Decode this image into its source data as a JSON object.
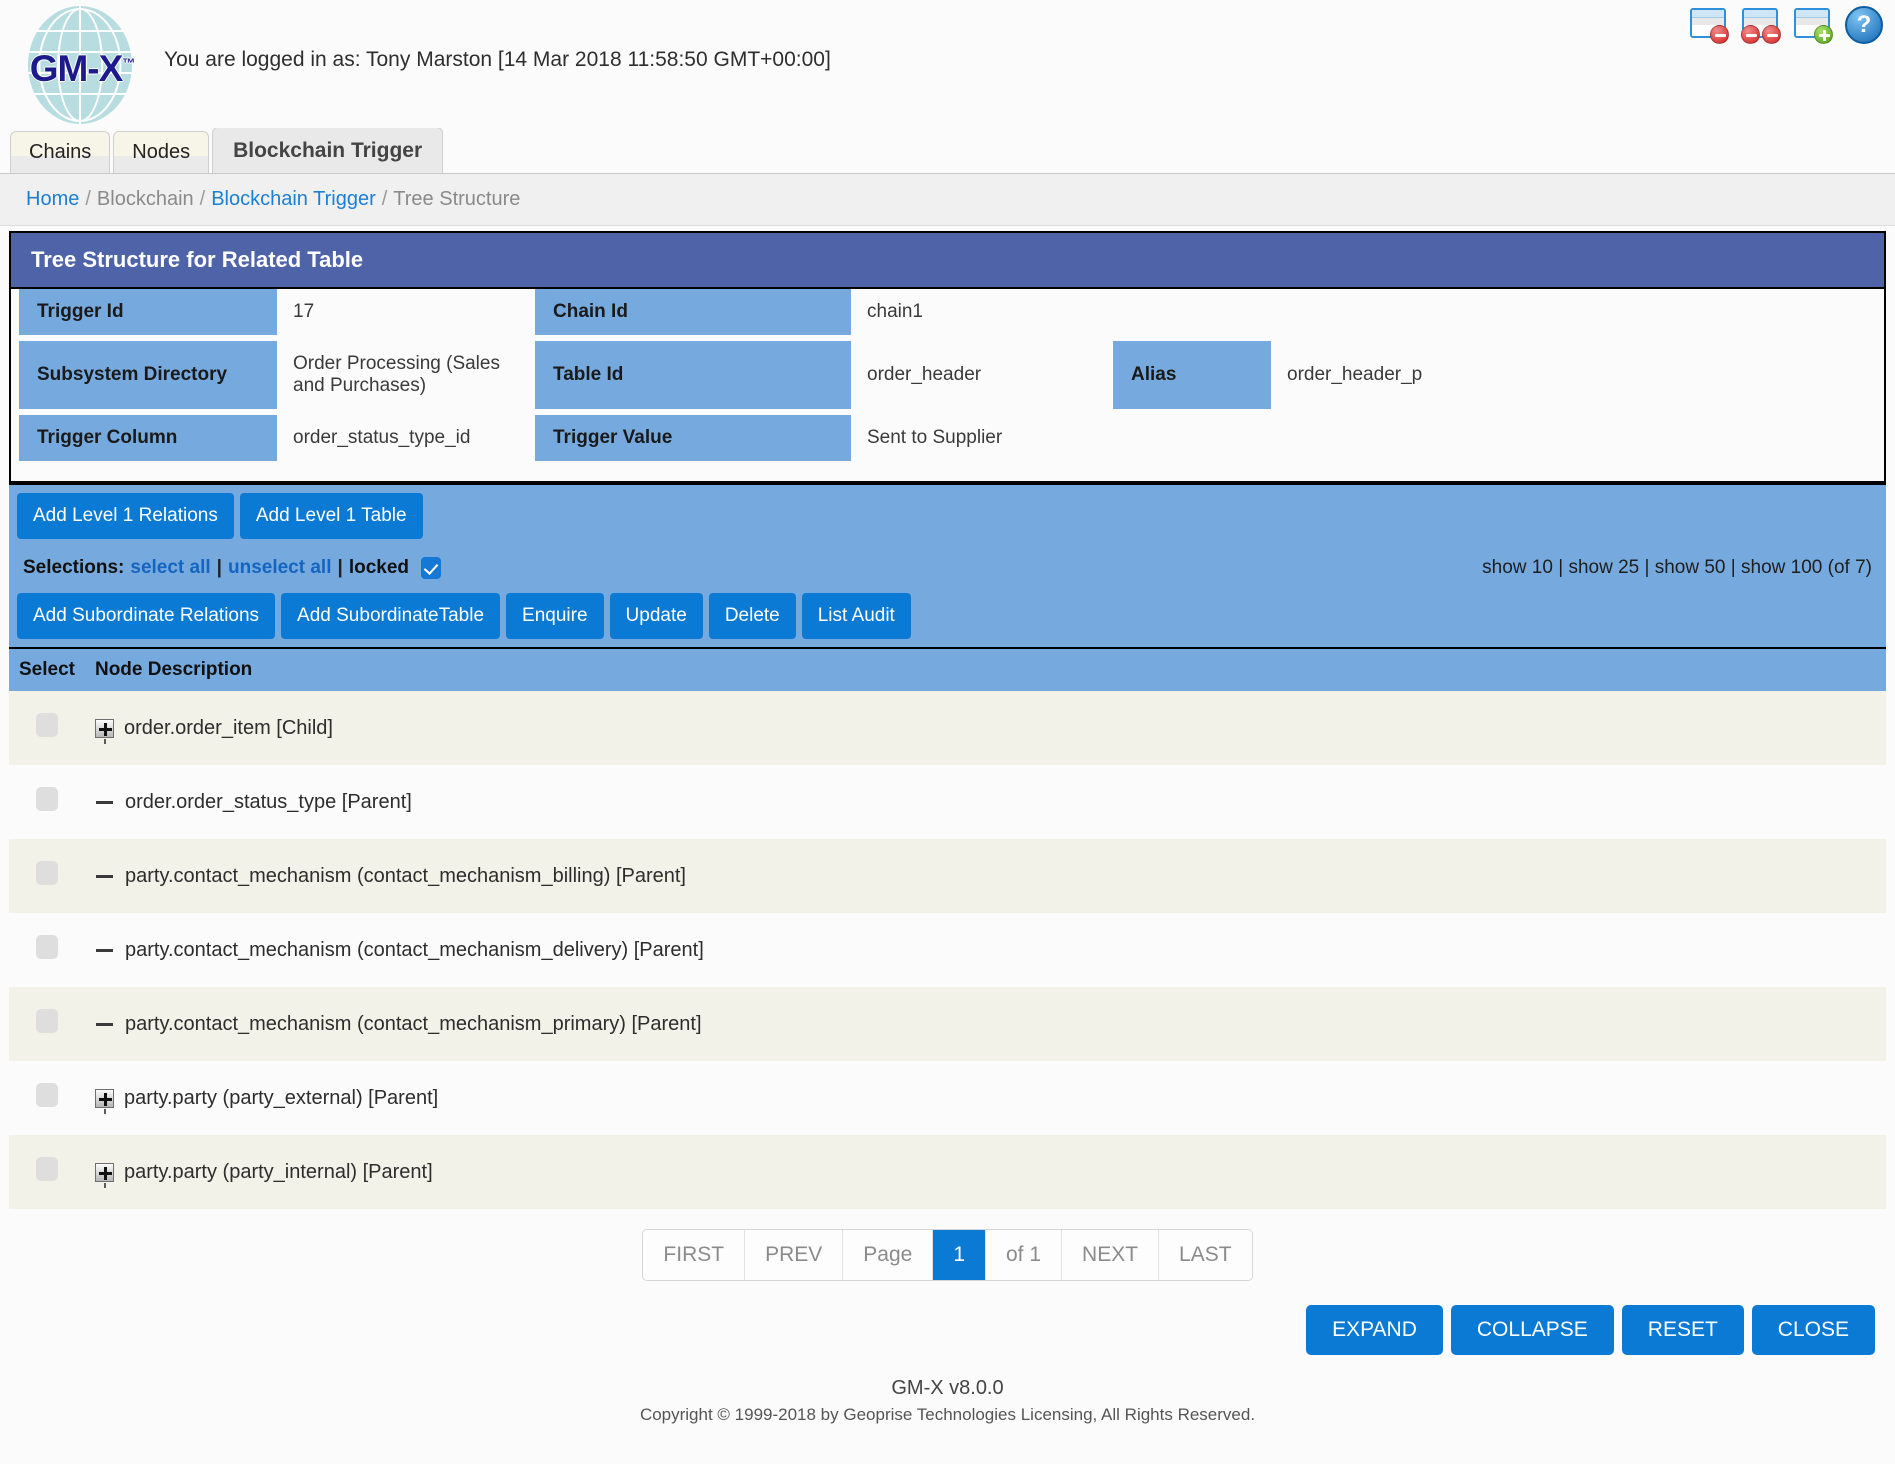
{
  "header": {
    "logo_text": "GM-X",
    "logo_tm": "™",
    "login_text": "You are logged in as: Tony Marston [14 Mar 2018 11:58:50 GMT+00:00]",
    "icons": [
      {
        "name": "close-window-icon",
        "title": "Close window"
      },
      {
        "name": "close-all-windows-icon",
        "title": "Close all windows"
      },
      {
        "name": "new-window-icon",
        "title": "New window"
      },
      {
        "name": "help-icon",
        "glyph": "?"
      }
    ]
  },
  "tabs": [
    {
      "label": "Chains",
      "active": false
    },
    {
      "label": "Nodes",
      "active": false
    },
    {
      "label": "Blockchain Trigger",
      "active": true
    }
  ],
  "breadcrumb": {
    "items": [
      {
        "label": "Home",
        "link": true
      },
      {
        "label": "Blockchain",
        "link": false
      },
      {
        "label": "Blockchain Trigger",
        "link": true
      },
      {
        "label": "Tree Structure",
        "link": false
      }
    ],
    "separator": "/"
  },
  "panel": {
    "title": "Tree Structure for Related Table",
    "fields": {
      "trigger_id_label": "Trigger Id",
      "trigger_id_value": "17",
      "chain_id_label": "Chain Id",
      "chain_id_value": "chain1",
      "subsystem_directory_label": "Subsystem Directory",
      "subsystem_directory_value": "Order Processing (Sales and Purchases)",
      "table_id_label": "Table Id",
      "table_id_value": "order_header",
      "alias_label": "Alias",
      "alias_value": "order_header_p",
      "trigger_column_label": "Trigger Column",
      "trigger_column_value": "order_status_type_id",
      "trigger_value_label": "Trigger Value",
      "trigger_value_value": "Sent to Supplier"
    }
  },
  "level1_toolbar": {
    "add_relations": "Add Level 1 Relations",
    "add_table": "Add Level 1 Table"
  },
  "selections": {
    "label": "Selections:",
    "select_all": "select all",
    "unselect_all": "unselect all",
    "locked": "locked",
    "locked_checked": true,
    "sep": "|",
    "show_options": [
      "show 10",
      "show 25",
      "show 50",
      "show 100"
    ],
    "total_text": "(of 7)"
  },
  "subordinate_toolbar": {
    "add_subordinate_relations": "Add Subordinate Relations",
    "add_subordinate_table": "Add SubordinateTable",
    "enquire": "Enquire",
    "update": "Update",
    "delete": "Delete",
    "list_audit": "List Audit"
  },
  "table": {
    "columns": [
      "Select",
      "Node Description"
    ],
    "rows": [
      {
        "icon": "plus-box-icon",
        "description": "order.order_item [Child]"
      },
      {
        "icon": "dash-icon",
        "description": "order.order_status_type [Parent]"
      },
      {
        "icon": "dash-icon",
        "description": "party.contact_mechanism (contact_mechanism_billing) [Parent]"
      },
      {
        "icon": "dash-icon",
        "description": "party.contact_mechanism (contact_mechanism_delivery) [Parent]"
      },
      {
        "icon": "dash-icon",
        "description": "party.contact_mechanism (contact_mechanism_primary) [Parent]"
      },
      {
        "icon": "plus-box-icon",
        "description": "party.party (party_external) [Parent]"
      },
      {
        "icon": "plus-box-icon",
        "description": "party.party (party_internal) [Parent]"
      }
    ]
  },
  "pager": {
    "first": "FIRST",
    "prev": "PREV",
    "page_label": "Page",
    "current_page": "1",
    "of_label": "of 1",
    "next": "NEXT",
    "last": "LAST"
  },
  "bottom_buttons": {
    "expand": "EXPAND",
    "collapse": "COLLAPSE",
    "reset": "RESET",
    "close": "CLOSE"
  },
  "footer": {
    "version": "GM-X v8.0.0",
    "copyright": "Copyright © 1999-2018 by Geoprise Technologies Licensing, All Rights Reserved."
  },
  "colors": {
    "panel_title_blue": "#4f63a9",
    "label_blue": "#76aadf",
    "button_blue": "#0b7ad4",
    "link_blue": "#1b7fd4",
    "row_alt": "#f2f2e8"
  }
}
